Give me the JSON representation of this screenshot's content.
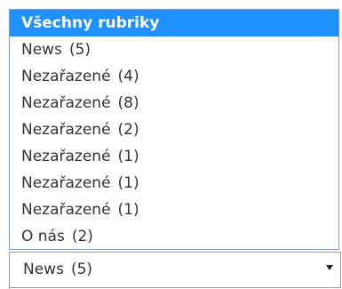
{
  "dropdown": {
    "options": [
      {
        "label": "Všechny rubriky"
      },
      {
        "label": "News",
        "count": "(5)"
      },
      {
        "label": "Nezařazené",
        "count": "(4)"
      },
      {
        "label": "Nezařazené",
        "count": "(8)"
      },
      {
        "label": "Nezařazené",
        "count": "(2)"
      },
      {
        "label": "Nezařazené",
        "count": "(1)"
      },
      {
        "label": "Nezařazené",
        "count": "(1)"
      },
      {
        "label": "Nezařazené",
        "count": "(1)"
      },
      {
        "label": "O nás",
        "count": "(2)"
      }
    ],
    "highlighted_index": 0
  },
  "select": {
    "selected_label": "News",
    "selected_count": "(5)",
    "arrow_icon": "triangle-down-icon"
  },
  "colors": {
    "highlight": "#1e90ff"
  }
}
